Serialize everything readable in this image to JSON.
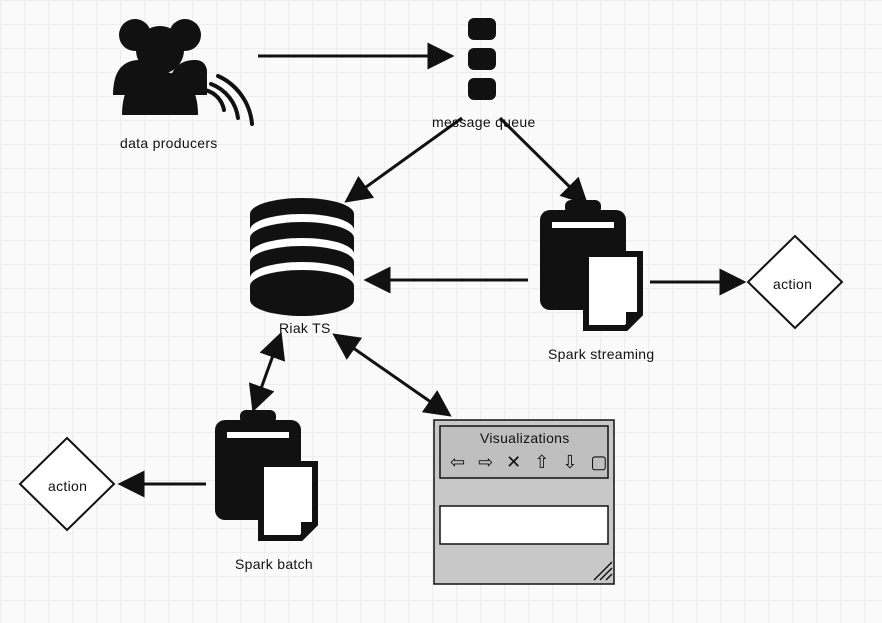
{
  "nodes": {
    "data_producers": {
      "label": "data producers"
    },
    "message_queue": {
      "label": "message queue"
    },
    "riak_ts": {
      "label": "Riak TS"
    },
    "spark_streaming": {
      "label": "Spark streaming"
    },
    "spark_batch": {
      "label": "Spark batch"
    },
    "visualizations": {
      "label": "Visualizations",
      "icon_row": "⇦ ⇨ ✕ ⇧ ⇩ ▢"
    },
    "action_left": {
      "label": "action"
    },
    "action_right": {
      "label": "action"
    }
  },
  "edges": [
    {
      "from": "data_producers",
      "to": "message_queue",
      "direction": "one"
    },
    {
      "from": "message_queue",
      "to": "riak_ts",
      "direction": "one"
    },
    {
      "from": "message_queue",
      "to": "spark_streaming",
      "direction": "one"
    },
    {
      "from": "spark_streaming",
      "to": "riak_ts",
      "direction": "one"
    },
    {
      "from": "spark_streaming",
      "to": "action_right",
      "direction": "one"
    },
    {
      "from": "riak_ts",
      "to": "spark_batch",
      "direction": "two"
    },
    {
      "from": "riak_ts",
      "to": "visualizations",
      "direction": "two"
    },
    {
      "from": "spark_batch",
      "to": "action_left",
      "direction": "one"
    }
  ]
}
